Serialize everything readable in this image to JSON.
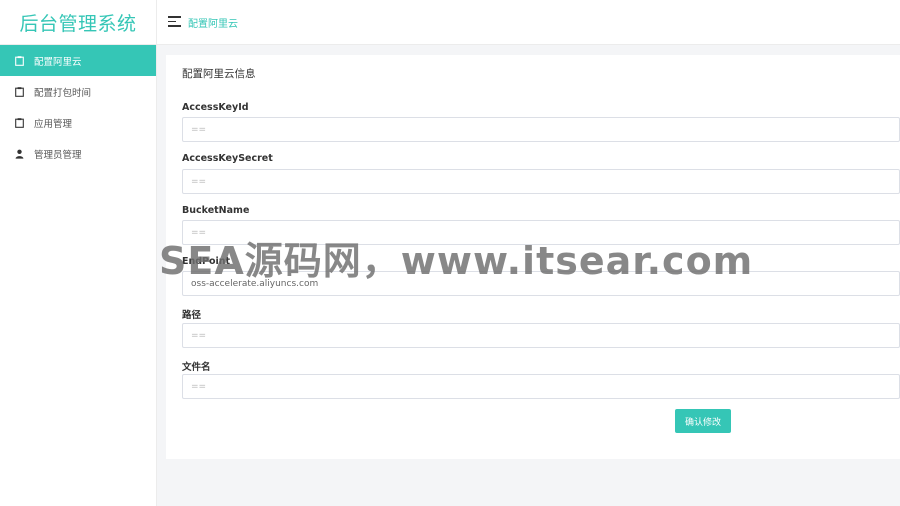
{
  "app": {
    "title": "后台管理系统"
  },
  "header": {
    "breadcrumb": "配置阿里云"
  },
  "sidebar": {
    "items": [
      {
        "label": "配置阿里云",
        "icon": "clipboard-icon",
        "active": true
      },
      {
        "label": "配置打包时间",
        "icon": "clipboard-icon",
        "active": false
      },
      {
        "label": "应用管理",
        "icon": "clipboard-icon",
        "active": false
      },
      {
        "label": "管理员管理",
        "icon": "user-icon",
        "active": false
      }
    ]
  },
  "form": {
    "title": "配置阿里云信息",
    "fields": [
      {
        "label": "AccessKeyId",
        "placeholder": "==",
        "value": ""
      },
      {
        "label": "AccessKeySecret",
        "placeholder": "==",
        "value": ""
      },
      {
        "label": "BucketName",
        "placeholder": "==",
        "value": ""
      },
      {
        "label": "EndPoint",
        "placeholder": "",
        "value": "oss-accelerate.aliyuncs.com"
      },
      {
        "label": "路径",
        "placeholder": "==",
        "value": ""
      },
      {
        "label": "文件名",
        "placeholder": "==",
        "value": ""
      }
    ],
    "submit_label": "确认修改"
  },
  "watermark": "SEA源码网，www.itsear.com",
  "colors": {
    "accent": "#35c6b6",
    "background": "#f4f5f7"
  }
}
